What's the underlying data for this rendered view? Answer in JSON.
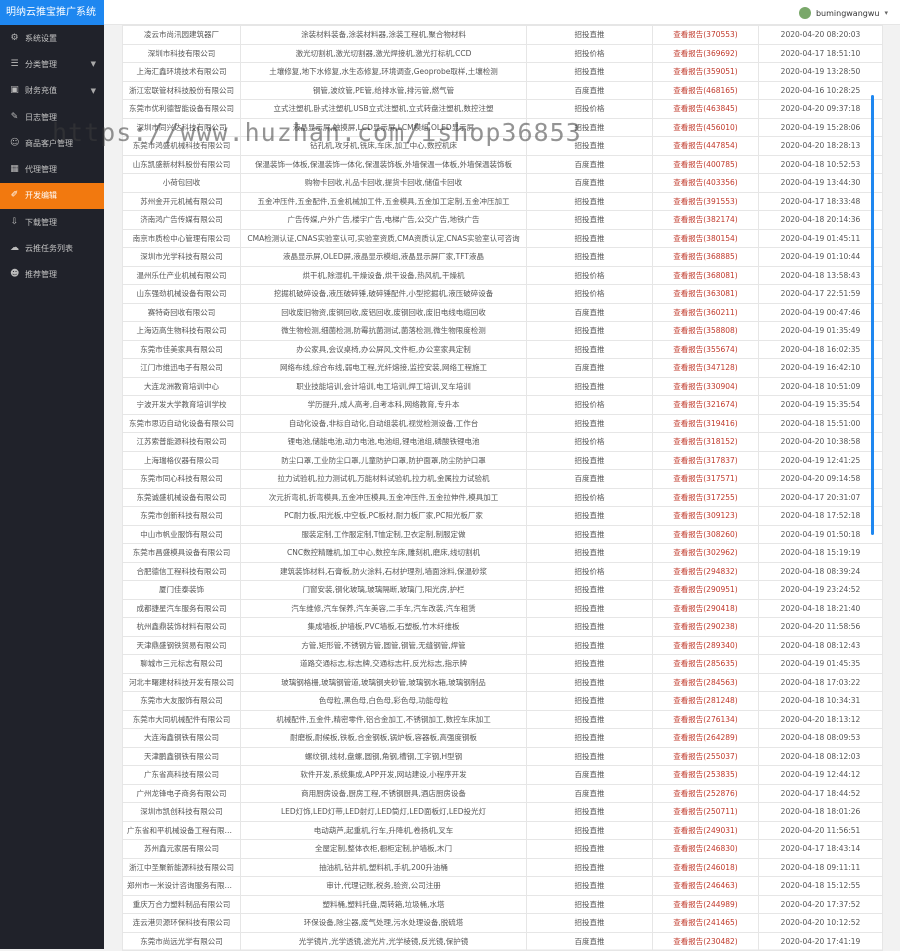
{
  "brand": "明纳云推宝推广系统",
  "user": {
    "name": "bumingwangwu"
  },
  "watermark": "https://www.huzhan.com/ishop36853",
  "nav": [
    {
      "label": "系统设置",
      "icon": "gear-icon",
      "arrow": false,
      "active": false
    },
    {
      "label": "分类管理",
      "icon": "list-icon",
      "arrow": true,
      "active": false
    },
    {
      "label": "财务充值",
      "icon": "wallet-icon",
      "arrow": true,
      "active": false
    },
    {
      "label": "日志管理",
      "icon": "log-icon",
      "arrow": false,
      "active": false
    },
    {
      "label": "商品客户管理",
      "icon": "user-icon",
      "arrow": false,
      "active": false
    },
    {
      "label": "代理管理",
      "icon": "grid-icon",
      "arrow": false,
      "active": false
    },
    {
      "label": "开发编辑",
      "icon": "edit-icon",
      "arrow": false,
      "active": true
    },
    {
      "label": "下载管理",
      "icon": "download-icon",
      "arrow": false,
      "active": false
    },
    {
      "label": "云推任务列表",
      "icon": "cloud-icon",
      "arrow": false,
      "active": false
    },
    {
      "label": "推荐管理",
      "icon": "users-icon",
      "arrow": false,
      "active": false
    }
  ],
  "rows": [
    [
      "凌云市尚汛园建筑器厂",
      "涂装材料装备,涂装材料器,涂装工程机,聚合物材料",
      "招投直推",
      "查看报告(370553)",
      "2020-04-20 08:20:03"
    ],
    [
      "深圳市科技有限公司",
      "激光切割机,激光切割器,激光焊接机,激光打标机,CCD",
      "招投价格",
      "查看报告(369692)",
      "2020-04-17 18:51:10"
    ],
    [
      "上海汇鑫环境技术有限公司",
      "土壤修复,地下水修复,水生态修复,环境调查,Geoprobe取样,土壤检测",
      "招投直推",
      "查看报告(359051)",
      "2020-04-19 13:28:50"
    ],
    [
      "浙江宏联管材科技股份有限公司",
      "钢管,波纹管,PE管,给排水管,排污管,燃气管",
      "百度直推",
      "查看报告(468165)",
      "2020-04-16 10:28:25"
    ],
    [
      "东莞市优利德智能设备有限公司",
      "立式注塑机,卧式注塑机,USB立式注塑机,立式转盘注塑机,数控注塑",
      "招投价格",
      "查看报告(463845)",
      "2020-04-20 09:37:18"
    ],
    [
      "深圳市同兴达科技有限公司",
      "液晶显示屏,触摸屏,LCD显示屏,LCM模组,OLED显示屏",
      "招投直推",
      "查看报告(456010)",
      "2020-04-19 15:28:06"
    ],
    [
      "东莞市鸿盛机械科技有限公司",
      "钻孔机,攻牙机,铣床,车床,加工中心,数控机床",
      "招投直推",
      "查看报告(447854)",
      "2020-04-20 18:28:13"
    ],
    [
      "山东凯盛新材料股份有限公司",
      "保温装饰一体板,保温装饰一体化,保温装饰板,外墙保温一体板,外墙保温装饰板",
      "百度直推",
      "查看报告(400785)",
      "2020-04-18 10:52:53"
    ],
    [
      "小荷包回收",
      "购物卡回收,礼品卡回收,提货卡回收,储值卡回收",
      "百度直推",
      "查看报告(403356)",
      "2020-04-19 13:44:30"
    ],
    [
      "苏州金开元机械有限公司",
      "五金冲压件,五金配件,五金机械加工件,五金模具,五金加工定制,五金冲压加工",
      "招投直推",
      "查看报告(391553)",
      "2020-04-17 18:33:48"
    ],
    [
      "济南鸿广告传媒有限公司",
      "广告传媒,户外广告,楼宇广告,电梯广告,公交广告,地铁广告",
      "招投直推",
      "查看报告(382174)",
      "2020-04-18 20:14:36"
    ],
    [
      "南京市质检中心管理有限公司",
      "CMA检测认证,CNAS实验室认可,实验室资质,CMA资质认定,CNAS实验室认可咨询",
      "招投直推",
      "查看报告(380154)",
      "2020-04-19 01:45:11"
    ],
    [
      "深圳市光学科技有限公司",
      "液晶显示屏,OLED屏,液晶显示模组,液晶显示屏厂家,TFT液晶",
      "招投直推",
      "查看报告(368885)",
      "2020-04-19 01:10:44"
    ],
    [
      "温州乐仕产业机械有限公司",
      "烘干机,除湿机,干燥设备,烘干设备,热风机,干燥机",
      "招投价格",
      "查看报告(368081)",
      "2020-04-18 13:58:43"
    ],
    [
      "山东强劲机械设备有限公司",
      "挖掘机破碎设备,液压破碎锤,破碎锤配件,小型挖掘机,液压破碎设备",
      "招投价格",
      "查看报告(363081)",
      "2020-04-17 22:51:59"
    ],
    [
      "赛特奇回收有限公司",
      "回收废旧物资,废铜回收,废铝回收,废钢回收,废旧电线电缆回收",
      "百度直推",
      "查看报告(360211)",
      "2020-04-19 00:47:46"
    ],
    [
      "上海迈高生物科技有限公司",
      "微生物检测,细菌检测,防霉抗菌测试,菌落检测,微生物限度检测",
      "招投直推",
      "查看报告(358808)",
      "2020-04-19 01:35:49"
    ],
    [
      "东莞市佳美家具有限公司",
      "办公家具,会议桌椅,办公屏风,文件柜,办公室家具定制",
      "招投直推",
      "查看报告(355674)",
      "2020-04-18 16:02:35"
    ],
    [
      "江门市维迅电子有限公司",
      "网络布线,综合布线,弱电工程,光纤熔接,监控安装,网络工程施工",
      "百度直推",
      "查看报告(347128)",
      "2020-04-19 16:42:10"
    ],
    [
      "大连龙洲教育培训中心",
      "职业技能培训,会计培训,电工培训,焊工培训,叉车培训",
      "招投直推",
      "查看报告(330904)",
      "2020-04-18 10:51:09"
    ],
    [
      "宁波开发大学教育培训学校",
      "学历提升,成人高考,自考本科,网络教育,专升本",
      "招投价格",
      "查看报告(321674)",
      "2020-04-19 15:35:54"
    ],
    [
      "东莞市思迈自动化设备有限公司",
      "自动化设备,非标自动化,自动组装机,视觉检测设备,工作台",
      "招投直推",
      "查看报告(319416)",
      "2020-04-18 15:51:00"
    ],
    [
      "江苏索普能源科技有限公司",
      "锂电池,储能电池,动力电池,电池组,锂电池组,磷酸铁锂电池",
      "招投价格",
      "查看报告(318152)",
      "2020-04-20 10:38:58"
    ],
    [
      "上海瑞格仪器有限公司",
      "防尘口罩,工业防尘口罩,儿童防护口罩,防护面罩,防尘防护口罩",
      "招投直推",
      "查看报告(317837)",
      "2020-04-19 12:41:25"
    ],
    [
      "东莞市同心科技有限公司",
      "拉力试验机,拉力测试机,万能材料试验机,拉力机,金属拉力试验机",
      "百度直推",
      "查看报告(317571)",
      "2020-04-20 09:14:58"
    ],
    [
      "东莞诚盛机械设备有限公司",
      "次元折弯机,折弯模具,五金冲压模具,五金冲压件,五金拉伸件,模具加工",
      "招投价格",
      "查看报告(317255)",
      "2020-04-17 20:31:07"
    ],
    [
      "东莞市创新科技有限公司",
      "PC耐力板,阳光板,中空板,PC板材,耐力板厂家,PC阳光板厂家",
      "招投直推",
      "查看报告(309123)",
      "2020-04-18 17:52:18"
    ],
    [
      "中山市帆业服饰有限公司",
      "服装定制,工作服定制,T恤定制,卫衣定制,制服定做",
      "招投直推",
      "查看报告(308260)",
      "2020-04-19 01:50:18"
    ],
    [
      "东莞市昌盛模具设备有限公司",
      "CNC数控精雕机,加工中心,数控车床,雕刻机,磨床,线切割机",
      "招投直推",
      "查看报告(302962)",
      "2020-04-18 15:19:19"
    ],
    [
      "合肥德信工程科技有限公司",
      "建筑装饰材料,石膏板,防火涂料,石材护理剂,墙面涂料,保温砂浆",
      "招投价格",
      "查看报告(294832)",
      "2020-04-18 08:39:24"
    ],
    [
      "厦门佳泰装饰",
      "门窗安装,钢化玻璃,玻璃隔断,玻璃门,阳光房,护栏",
      "招投直推",
      "查看报告(290951)",
      "2020-04-19 23:24:52"
    ],
    [
      "成都捷星汽车服务有限公司",
      "汽车维修,汽车保养,汽车美容,二手车,汽车改装,汽车租赁",
      "招投直推",
      "查看报告(290418)",
      "2020-04-18 18:21:40"
    ],
    [
      "杭州鑫鼎装饰材料有限公司",
      "集成墙板,护墙板,PVC墙板,石塑板,竹木纤维板",
      "招投直推",
      "查看报告(290238)",
      "2020-04-20 11:58:56"
    ],
    [
      "天津鼎盛钢铁贸易有限公司",
      "方管,矩形管,不锈钢方管,圆管,钢管,无缝钢管,焊管",
      "招投直推",
      "查看报告(289340)",
      "2020-04-18 08:12:43"
    ],
    [
      "聊城市三元标志有限公司",
      "道路交通标志,标志牌,交通标志杆,反光标志,指示牌",
      "招投直推",
      "查看报告(285635)",
      "2020-04-19 01:45:35"
    ],
    [
      "河北丰曙建材科技开发有限公司",
      "玻璃钢格栅,玻璃钢管道,玻璃钢夹砂管,玻璃钢水箱,玻璃钢制品",
      "招投直推",
      "查看报告(284563)",
      "2020-04-18 17:03:22"
    ],
    [
      "东莞市大友服饰有限公司",
      "色母粒,黑色母,白色母,彩色母,功能母粒",
      "招投直推",
      "查看报告(281248)",
      "2020-04-18 10:34:31"
    ],
    [
      "东莞市大同机械配件有限公司",
      "机械配件,五金件,精密零件,铝合金加工,不锈钢加工,数控车床加工",
      "招投直推",
      "查看报告(276134)",
      "2020-04-20 18:13:12"
    ],
    [
      "大连海鑫钢铁有限公司",
      "耐磨板,耐候板,铁板,合金钢板,锅炉板,容器板,高强度钢板",
      "招投直推",
      "查看报告(264289)",
      "2020-04-18 08:09:53"
    ],
    [
      "天津鹏鑫钢铁有限公司",
      "螺纹钢,线材,盘螺,圆钢,角钢,槽钢,工字钢,H型钢",
      "招投直推",
      "查看报告(255037)",
      "2020-04-18 08:12:03"
    ],
    [
      "广东省高科技有限公司",
      "软件开发,系统集成,APP开发,网站建设,小程序开发",
      "百度直推",
      "查看报告(253835)",
      "2020-04-19 12:44:12"
    ],
    [
      "广州龙锋电子商务有限公司",
      "商用厨房设备,厨房工程,不锈钢厨具,酒店厨房设备",
      "百度直推",
      "查看报告(252876)",
      "2020-04-17 18:44:52"
    ],
    [
      "深圳市凯创科技有限公司",
      "LED灯饰,LED灯带,LED射灯,LED筒灯,LED面板灯,LED投光灯",
      "招投直推",
      "查看报告(250711)",
      "2020-04-18 18:01:26"
    ],
    [
      "广东省和平机械设备工程有限公司",
      "电动葫芦,起重机,行车,升降机,卷扬机,叉车",
      "招投直推",
      "查看报告(249031)",
      "2020-04-20 11:56:51"
    ],
    [
      "苏州鑫元家居有限公司",
      "全屋定制,整体衣柜,橱柜定制,护墙板,木门",
      "招投直推",
      "查看报告(246830)",
      "2020-04-17 18:43:14"
    ],
    [
      "浙江中圣聚新能源科技有限公司",
      "抽油机,钻井机,塑料机,手机,200升油桶",
      "招投直推",
      "查看报告(246018)",
      "2020-04-18 09:11:11"
    ],
    [
      "郑州市一米设计咨询服务有限公司",
      "审计,代理记账,税务,验资,公司注册",
      "招投直推",
      "查看报告(246463)",
      "2020-04-18 15:12:55"
    ],
    [
      "重庆万合力塑料制品有限公司",
      "塑料桶,塑料托盘,周转箱,垃圾桶,水塔",
      "招投直推",
      "查看报告(244989)",
      "2020-04-20 17:37:52"
    ],
    [
      "连云港贝源环保科技有限公司",
      "环保设备,除尘器,废气处理,污水处理设备,脱硫塔",
      "招投直推",
      "查看报告(241465)",
      "2020-04-20 10:12:52"
    ],
    [
      "东莞市尚远光学有限公司",
      "光学镜片,光学透镜,滤光片,光学棱镜,反光镜,保护镜",
      "百度直推",
      "查看报告(230482)",
      "2020-04-20 17:41:19"
    ]
  ],
  "colors": {
    "accent": "#f2790f",
    "brand_bg": "#1e87f0",
    "status": "#c0392b"
  }
}
